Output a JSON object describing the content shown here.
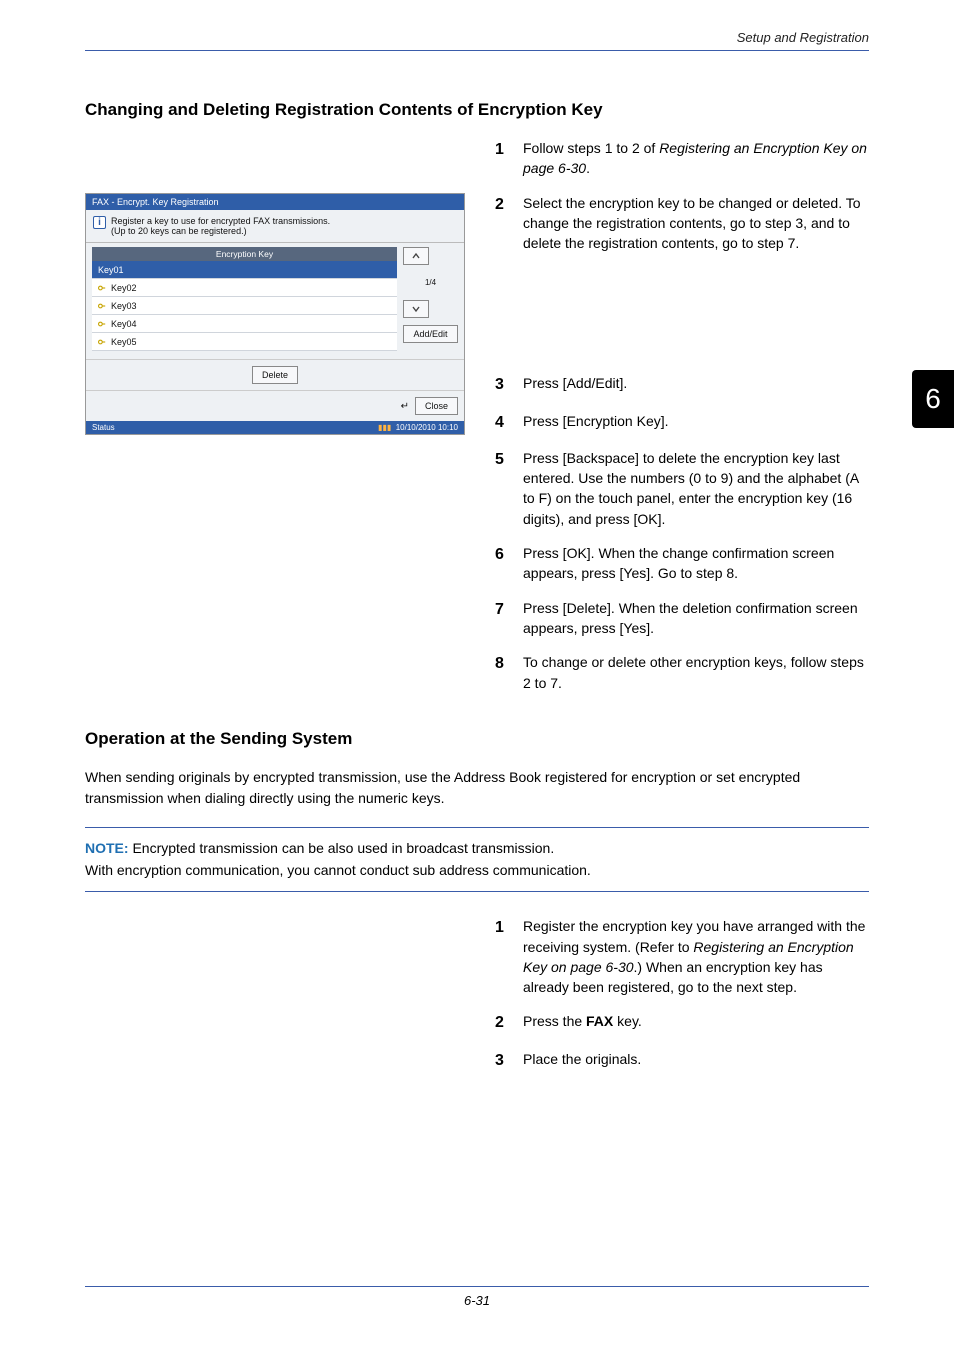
{
  "header": {
    "section_label": "Setup and Registration"
  },
  "side_tab": {
    "number": "6"
  },
  "section1": {
    "title": "Changing and Deleting Registration Contents of Encryption Key",
    "steps": {
      "s1_num": "1",
      "s1_a": "Follow steps 1 to 2 of ",
      "s1_b": "Registering an Encryption Key on page 6-30",
      "s1_c": ".",
      "s2_num": "2",
      "s2": "Select the encryption key to be changed or deleted. To change the registration contents, go to step 3, and to delete the registration contents, go to step 7.",
      "s3_num": "3",
      "s3": "Press [Add/Edit].",
      "s4_num": "4",
      "s4": "Press [Encryption Key].",
      "s5_num": "5",
      "s5": "Press [Backspace] to delete the encryption key last entered. Use the numbers (0 to 9) and the alphabet (A to F) on the touch panel, enter the encryption key (16 digits), and press [OK].",
      "s6_num": "6",
      "s6": "Press [OK]. When the change confirmation screen appears, press [Yes]. Go to step 8.",
      "s7_num": "7",
      "s7": "Press [Delete]. When the deletion confirmation screen appears, press [Yes].",
      "s8_num": "8",
      "s8": "To change or delete other encryption keys, follow steps 2 to 7."
    }
  },
  "panel": {
    "title": "FAX - Encrypt. Key Registration",
    "note_line1": "Register a key to use for encrypted FAX transmissions.",
    "note_line2": "(Up to 20 keys can be registered.)",
    "list_header": "Encryption Key",
    "rows": [
      "Key01",
      "Key02",
      "Key03",
      "Key04",
      "Key05"
    ],
    "page_indicator": "1/4",
    "add_edit": "Add/Edit",
    "delete": "Delete",
    "close": "Close",
    "status": "Status",
    "timestamp": "10/10/2010  10:10"
  },
  "section2": {
    "title": "Operation at the Sending System",
    "intro": "When sending originals by encrypted transmission, use the Address Book registered for encryption or set encrypted transmission when dialing directly using the numeric keys.",
    "note_label": "NOTE:",
    "note_l1": " Encrypted transmission can be also used in broadcast transmission.",
    "note_l2": "With encryption communication, you cannot conduct sub address communication.",
    "steps": {
      "s1_num": "1",
      "s1_a": "Register the encryption key you have arranged with the receiving system. (Refer to ",
      "s1_b": "Registering an Encryption Key on page 6-30",
      "s1_c": ".) When an encryption key has already been registered, go to the next step.",
      "s2_num": "2",
      "s2_a": "Press the ",
      "s2_b": "FAX",
      "s2_c": " key.",
      "s3_num": "3",
      "s3": "Place the originals."
    }
  },
  "footer": {
    "page": "6-31"
  }
}
